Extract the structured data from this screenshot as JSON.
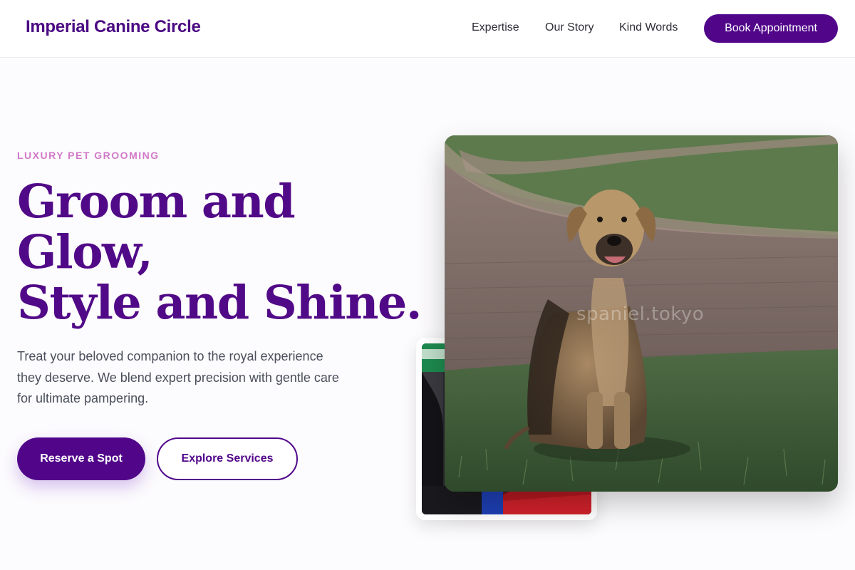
{
  "brand": {
    "name": "Imperial Canine Circle"
  },
  "nav": {
    "links": [
      "Expertise",
      "Our Story",
      "Kind Words"
    ],
    "cta_label": "Book Appointment"
  },
  "hero": {
    "eyebrow": "LUXURY PET GROOMING",
    "headline_lines": [
      "Groom and",
      "Glow,",
      "Style and Shine."
    ],
    "lede": "Treat your beloved companion to the royal experience they deserve. We blend expert precision with gentle care for ultimate pampering.",
    "primary_cta": "Reserve a Spot",
    "secondary_cta": "Explore Services"
  },
  "images": {
    "main_watermark": "spaniel.tokyo"
  },
  "colors": {
    "brand_purple": "#51068a",
    "eyebrow_pink": "#d17ac8",
    "body_text": "#4a4f5c"
  }
}
